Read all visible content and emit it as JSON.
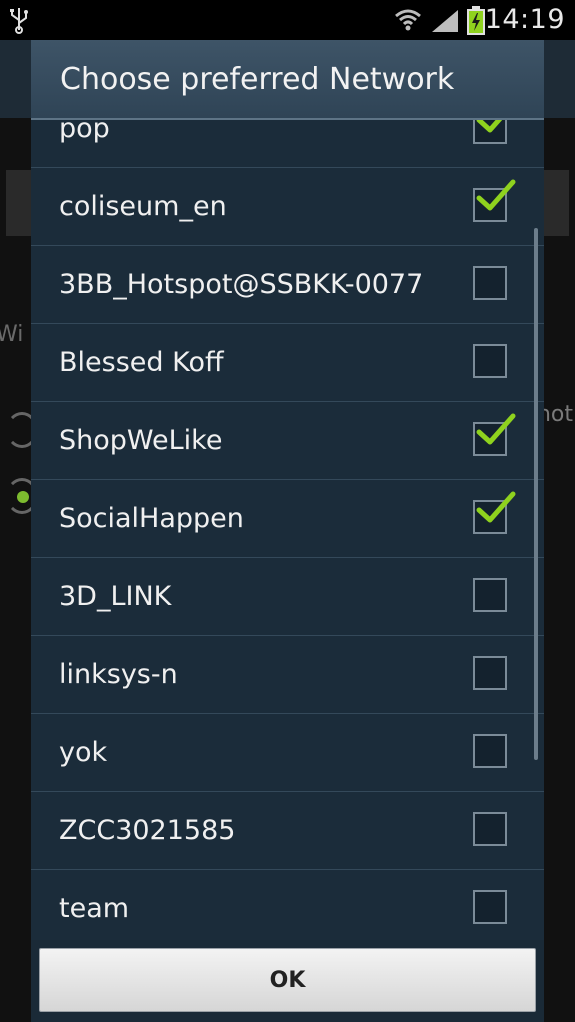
{
  "status_bar": {
    "time": "14:19",
    "icons": [
      "usb-icon",
      "wifi-icon",
      "signal-icon",
      "battery-charging-icon"
    ]
  },
  "background": {
    "left_fragment": "Wi",
    "right_fragment": "hot"
  },
  "dialog": {
    "title": "Choose preferred Network",
    "networks": [
      {
        "name": "pop",
        "checked": true
      },
      {
        "name": "coliseum_en",
        "checked": true
      },
      {
        "name": "3BB_Hotspot@SSBKK-0077",
        "checked": false
      },
      {
        "name": "Blessed Koff",
        "checked": false
      },
      {
        "name": "ShopWeLike",
        "checked": true
      },
      {
        "name": "SocialHappen",
        "checked": true
      },
      {
        "name": "3D_LINK",
        "checked": false
      },
      {
        "name": "linksys-n",
        "checked": false
      },
      {
        "name": "yok",
        "checked": false
      },
      {
        "name": "ZCC3021585",
        "checked": false
      },
      {
        "name": "team",
        "checked": false
      }
    ],
    "ok_label": "OK"
  },
  "colors": {
    "accent_check": "#8fd21e",
    "dialog_bg": "#1b2c3a",
    "title_bg": "#3e5467"
  }
}
